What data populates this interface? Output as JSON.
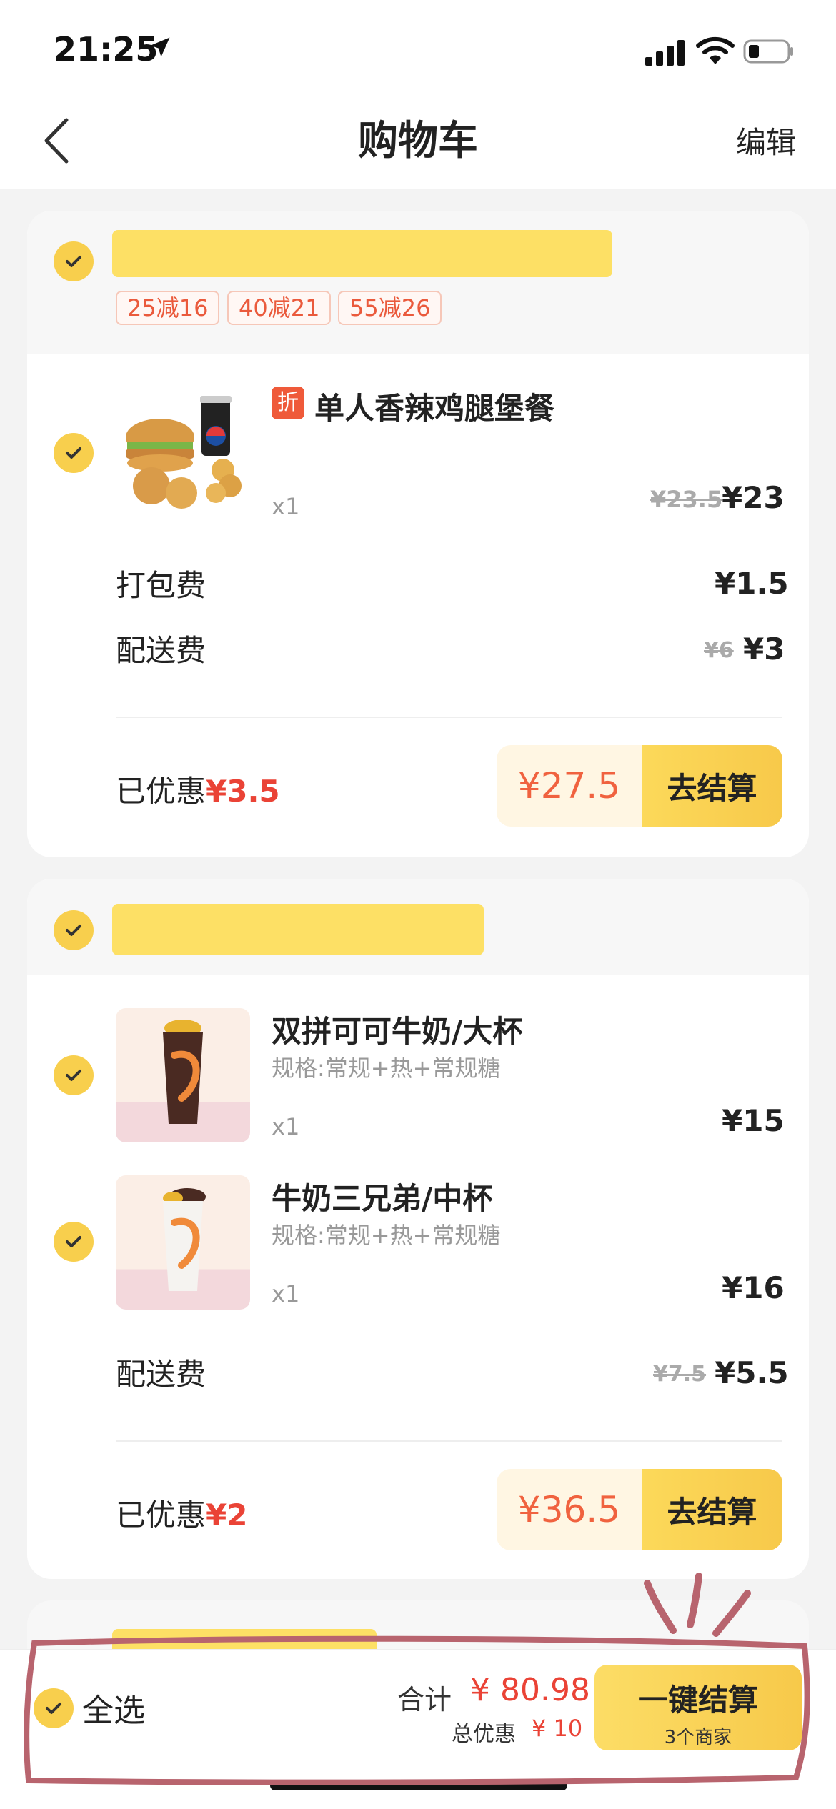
{
  "status": {
    "time": "21:25"
  },
  "nav": {
    "title": "购物车",
    "edit": "编辑"
  },
  "store1": {
    "promos": [
      "25减16",
      "40减21",
      "55减26"
    ],
    "item": {
      "badge": "折",
      "name": "单人香辣鸡腿堡餐",
      "qty": "x1",
      "old_price": "¥23.5",
      "price": "¥23"
    },
    "packing_label": "打包费",
    "packing_price": "¥1.5",
    "delivery_label": "配送费",
    "delivery_old": "¥6",
    "delivery_price": "¥3",
    "saved_label": "已优惠",
    "saved_amount": "¥3.5",
    "total": "¥27.5",
    "checkout": "去结算"
  },
  "store2": {
    "items": [
      {
        "name": "双拼可可牛奶/大杯",
        "spec": "规格:常规+热+常规糖",
        "qty": "x1",
        "price": "¥15"
      },
      {
        "name": "牛奶三兄弟/中杯",
        "spec": "规格:常规+热+常规糖",
        "qty": "x1",
        "price": "¥16"
      }
    ],
    "delivery_label": "配送费",
    "delivery_old": "¥7.5",
    "delivery_price": "¥5.5",
    "saved_label": "已优惠",
    "saved_amount": "¥2",
    "total": "¥36.5",
    "checkout": "去结算"
  },
  "bottom": {
    "select_all": "全选",
    "sum_label": "合计",
    "sum_amount": "¥ 80.98",
    "discount_label": "总优惠",
    "discount_amount": "¥ 10",
    "checkout_all": "一键结算",
    "merchants": "3个商家"
  },
  "colors": {
    "accent": "#f8cf4d",
    "price_red": "#ea4336",
    "annotation": "#b8646e"
  }
}
